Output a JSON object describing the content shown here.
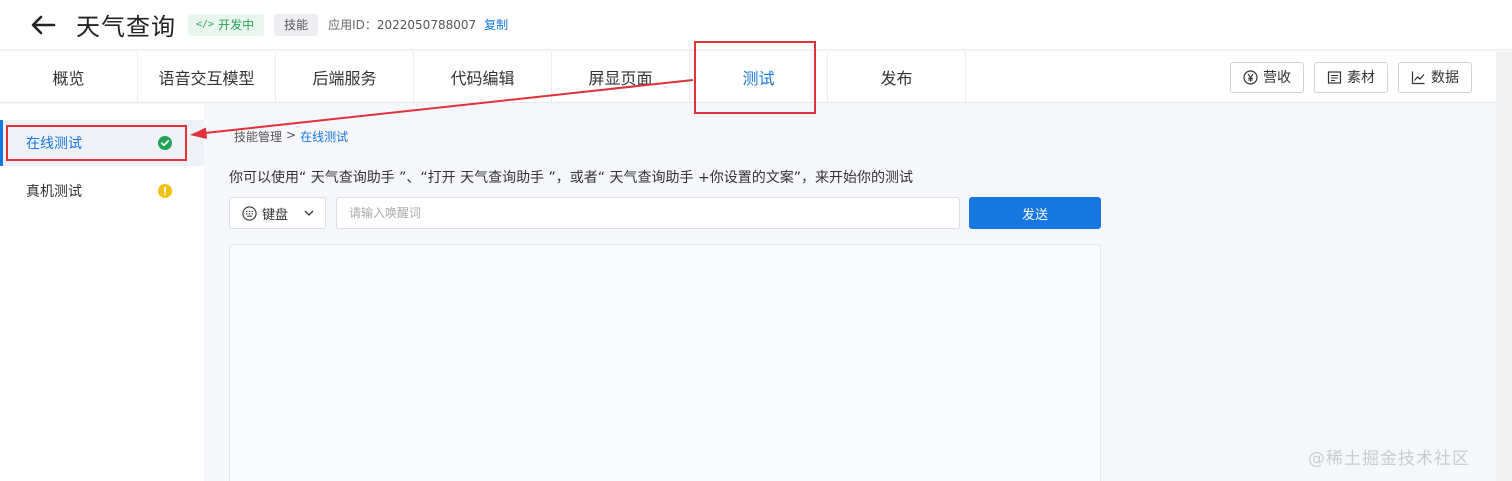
{
  "header": {
    "title": "天气查询",
    "status_badge": "开发中",
    "type_badge": "技能",
    "app_id_label": "应用ID：",
    "app_id": "2022050788007",
    "copy_label": "复制"
  },
  "topnav": {
    "tabs": [
      {
        "label": "概览"
      },
      {
        "label": "语音交互模型"
      },
      {
        "label": "后端服务"
      },
      {
        "label": "代码编辑"
      },
      {
        "label": "屏显页面"
      },
      {
        "label": "测试",
        "active": true
      },
      {
        "label": "发布"
      }
    ],
    "actions": [
      {
        "label": "营收",
        "icon": "yen-icon"
      },
      {
        "label": "素材",
        "icon": "material-icon"
      },
      {
        "label": "数据",
        "icon": "chart-icon"
      }
    ]
  },
  "sidebar": {
    "items": [
      {
        "label": "在线测试",
        "status": "success",
        "active": true
      },
      {
        "label": "真机测试",
        "status": "warning"
      }
    ]
  },
  "main": {
    "breadcrumb": {
      "parent": "技能管理",
      "separator": ">",
      "current": "在线测试"
    },
    "hint": "你可以使用“ 天气查询助手 ”、“打开 天气查询助手 ”，或者“ 天气查询助手 +你设置的文案”，来开始你的测试",
    "input_mode": "键盘",
    "wake_placeholder": "请输入唤醒词",
    "send_label": "发送"
  },
  "watermark": "@稀土掘金技术社区",
  "colors": {
    "accent": "#1677e0",
    "success": "#22a355",
    "warning": "#f4c20d",
    "annotation": "#e0323a"
  }
}
